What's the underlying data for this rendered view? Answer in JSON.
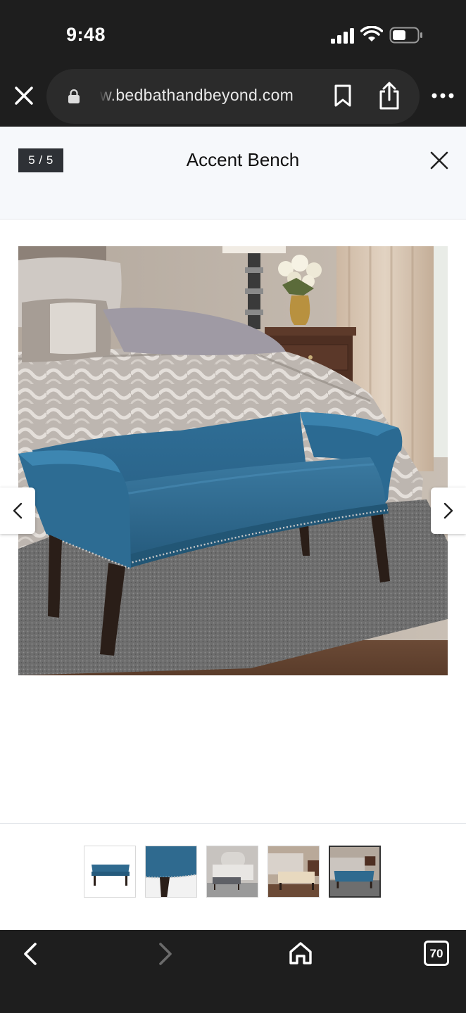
{
  "status_bar": {
    "time": "9:48"
  },
  "browser": {
    "url": "w.bedbathandbeyond.com",
    "tabs_count": "70"
  },
  "gallery": {
    "counter": "5 / 5",
    "title": "Accent Bench",
    "thumbnails": [
      {
        "name": "thumb-bench-front"
      },
      {
        "name": "thumb-bench-detail"
      },
      {
        "name": "thumb-bench-grey-room"
      },
      {
        "name": "thumb-bench-cream-room"
      },
      {
        "name": "thumb-bench-blue-room"
      }
    ],
    "active_index": 4
  },
  "colors": {
    "bench_blue": "#2f6a8f",
    "dark_chrome": "#1e1e1e",
    "header_bg": "#f6f8fb"
  }
}
